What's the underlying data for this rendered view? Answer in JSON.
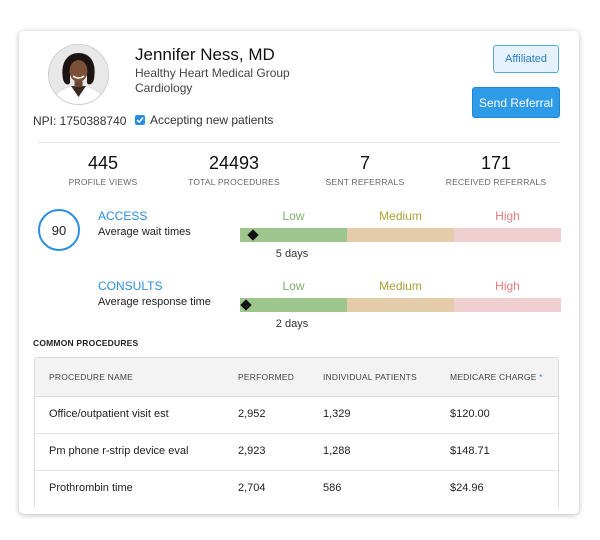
{
  "profile": {
    "name": "Jennifer Ness, MD",
    "organization": "Healthy Heart Medical Group",
    "specialty": "Cardiology",
    "npi": "NPI: 1750388740",
    "accepting_label": "Accepting new patients",
    "accepting_checked": true
  },
  "buttons": {
    "affiliated": "Affiliated",
    "send_referral": "Send Referral"
  },
  "stats": [
    {
      "value": "445",
      "label": "PROFILE VIEWS"
    },
    {
      "value": "24493",
      "label": "TOTAL PROCEDURES"
    },
    {
      "value": "7",
      "label": "SENT REFERRALS"
    },
    {
      "value": "171",
      "label": "RECEIVED REFERRALS"
    }
  ],
  "score": "90",
  "levels": {
    "low": "Low",
    "medium": "Medium",
    "high": "High"
  },
  "metrics": [
    {
      "title": "ACCESS",
      "subtitle": "Average wait times",
      "value_text": "5 days",
      "marker_fraction": 0.04
    },
    {
      "title": "CONSULTS",
      "subtitle": "Average response time",
      "value_text": "2 days",
      "marker_fraction": 0.02
    }
  ],
  "colors": {
    "accent": "#2a8fe0",
    "low": "#9cc68e",
    "medium": "#e4ccaa",
    "high": "#efcfcf",
    "low_text": "#7fae6a",
    "medium_text": "#a9a235",
    "high_text": "#e07b7b"
  },
  "procedures": {
    "title": "COMMON PROCEDURES",
    "headers": [
      "PROCEDURE NAME",
      "PERFORMED",
      "INDIVIDUAL PATIENTS",
      "MEDICARE CHARGE"
    ],
    "header_marker": "*",
    "rows": [
      [
        "Office/outpatient visit est",
        "2,952",
        "1,329",
        "$120.00"
      ],
      [
        "Pm phone r-strip device eval",
        "2,923",
        "1,288",
        "$148.71"
      ],
      [
        "Prothrombin time",
        "2,704",
        "586",
        "$24.96"
      ]
    ]
  }
}
